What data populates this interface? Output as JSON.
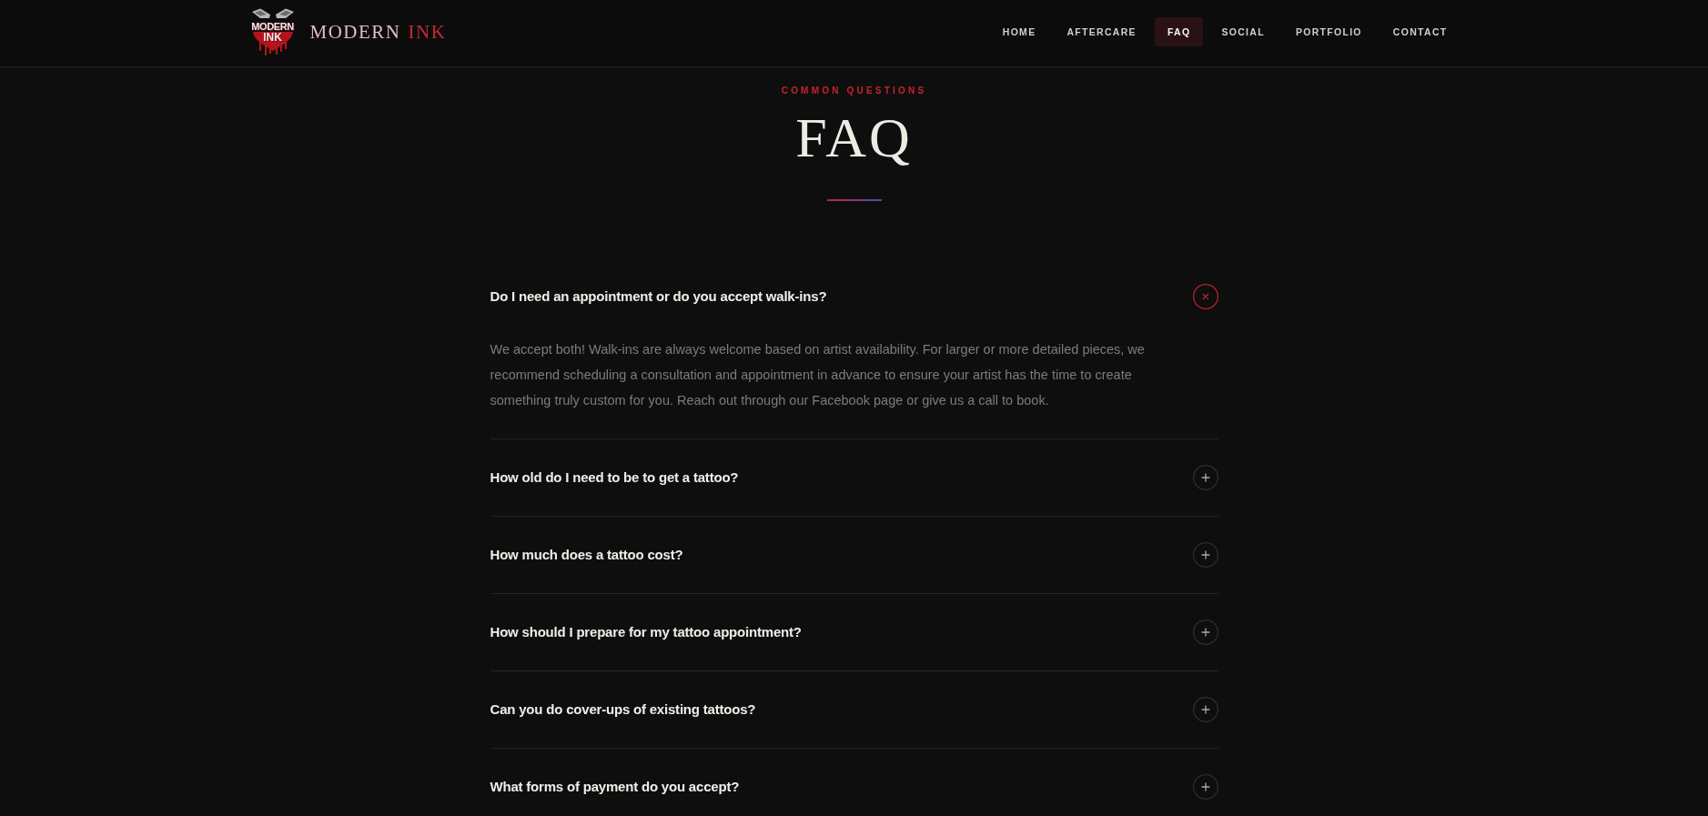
{
  "logo": {
    "emblem_lines": [
      "MODERN",
      "INK"
    ],
    "brand_words": [
      "MODERN",
      "INK"
    ]
  },
  "nav": [
    {
      "label": "HOME",
      "selected": false
    },
    {
      "label": "AFTERCARE",
      "selected": false
    },
    {
      "label": "FAQ",
      "selected": true
    },
    {
      "label": "SOCIAL",
      "selected": false
    },
    {
      "label": "PORTFOLIO",
      "selected": false
    },
    {
      "label": "CONTACT",
      "selected": false
    }
  ],
  "hero": {
    "eyebrow": "COMMON QUESTIONS",
    "title": "FAQ"
  },
  "faq": [
    {
      "question": "Do I need an appointment or do you accept walk-ins?",
      "expanded": true,
      "answer": "We accept both! Walk-ins are always welcome based on artist availability. For larger or more detailed pieces, we recommend scheduling a consultation and appointment in advance to ensure your artist has the time to create something truly custom for you. Reach out through our Facebook page or give us a call to book."
    },
    {
      "question": "How old do I need to be to get a tattoo?",
      "expanded": false
    },
    {
      "question": "How much does a tattoo cost?",
      "expanded": false
    },
    {
      "question": "How should I prepare for my tattoo appointment?",
      "expanded": false
    },
    {
      "question": "Can you do cover-ups of existing tattoos?",
      "expanded": false
    },
    {
      "question": "What forms of payment do you accept?",
      "expanded": false
    }
  ]
}
